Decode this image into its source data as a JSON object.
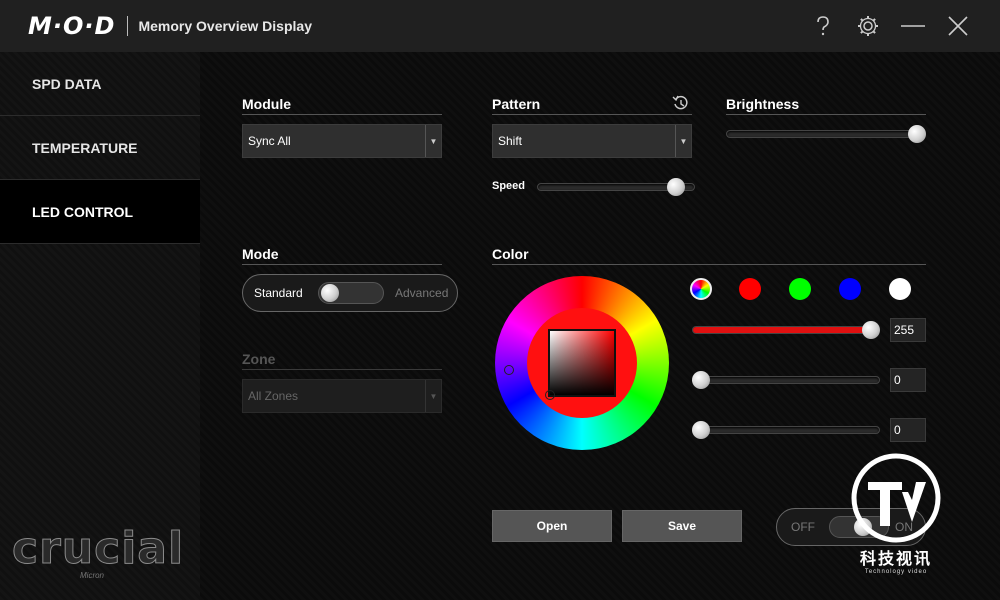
{
  "titlebar": {
    "logo": "M·O·D",
    "title": "Memory Overview Display"
  },
  "sidebar": {
    "items": [
      {
        "label": "SPD DATA",
        "active": false
      },
      {
        "label": "TEMPERATURE",
        "active": false
      },
      {
        "label": "LED CONTROL",
        "active": true
      }
    ],
    "brand": "crucial",
    "brand_sub": "Micron"
  },
  "module": {
    "label": "Module",
    "value": "Sync All"
  },
  "pattern": {
    "label": "Pattern",
    "value": "Shift"
  },
  "brightness": {
    "label": "Brightness",
    "level": 1.0
  },
  "speed": {
    "label": "Speed",
    "level": 0.93
  },
  "mode": {
    "label": "Mode",
    "standard": "Standard",
    "advanced": "Advanced"
  },
  "zone": {
    "label": "Zone",
    "value": "All Zones"
  },
  "color": {
    "label": "Color",
    "swatches": [
      "rainbow",
      "#ff0000",
      "#00ff00",
      "#0000ff",
      "#ffffff"
    ],
    "red": "255",
    "green": "0",
    "blue": "0",
    "accent": "#ff1a1a"
  },
  "buttons": {
    "open": "Open",
    "save": "Save"
  },
  "power": {
    "off": "OFF",
    "on": "ON"
  },
  "watermark": {
    "cn": "科技视讯",
    "en": "Technology video"
  }
}
